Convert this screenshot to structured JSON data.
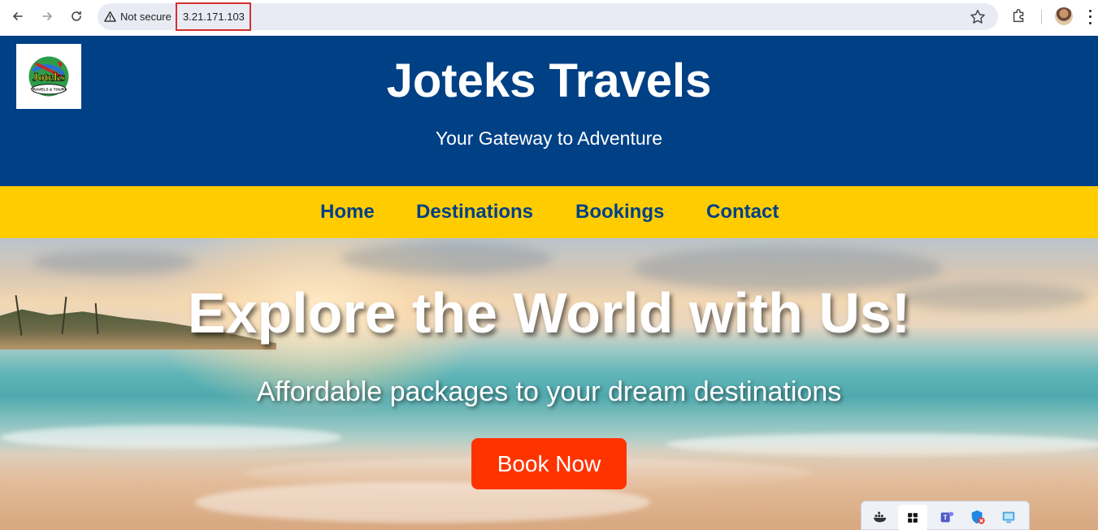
{
  "browser": {
    "security_label": "Not secure",
    "url": "3.21.171.103",
    "icons": [
      "back-arrow-icon",
      "forward-arrow-icon",
      "reload-icon",
      "warning-icon",
      "star-icon",
      "extensions-icon",
      "profile-avatar",
      "menu-icon"
    ]
  },
  "header": {
    "title": "Joteks Travels",
    "tagline": "Your Gateway to Adventure",
    "logo_text": "Joteks",
    "logo_subtext": "TRAVELS & TOURS",
    "background": "#004085"
  },
  "nav": {
    "background": "#ffcc00",
    "links": [
      {
        "label": "Home"
      },
      {
        "label": "Destinations"
      },
      {
        "label": "Bookings"
      },
      {
        "label": "Contact"
      }
    ]
  },
  "hero": {
    "title": "Explore the World with Us!",
    "subtitle": "Affordable packages to your dream destinations",
    "cta_label": "Book Now",
    "cta_color": "#ff3300"
  },
  "tray": {
    "icons": [
      "docker-icon",
      "app-grid-icon",
      "teams-icon",
      "defender-icon",
      "network-icon"
    ]
  }
}
